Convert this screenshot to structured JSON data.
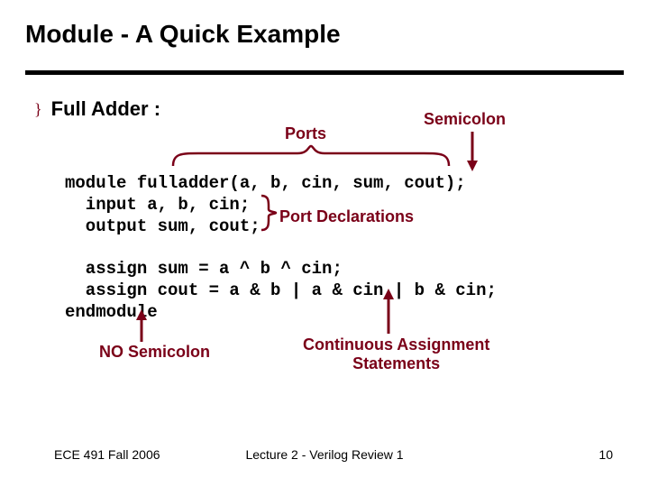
{
  "title": "Module - A Quick Example",
  "bullet": "Full Adder :",
  "annotations": {
    "ports": "Ports",
    "semicolon": "Semicolon",
    "port_declarations": "Port Declarations",
    "no_semicolon": "NO Semicolon",
    "continuous_assignment": "Continuous Assignment\nStatements"
  },
  "code": "module fulladder(a, b, cin, sum, cout);\n  input a, b, cin;\n  output sum, cout;\n\n  assign sum = a ^ b ^ cin;\n  assign cout = a & b | a & cin | b & cin;\nendmodule",
  "footer": {
    "left": "ECE 491 Fall 2006",
    "center": "Lecture 2 - Verilog Review 1",
    "right": "10"
  }
}
